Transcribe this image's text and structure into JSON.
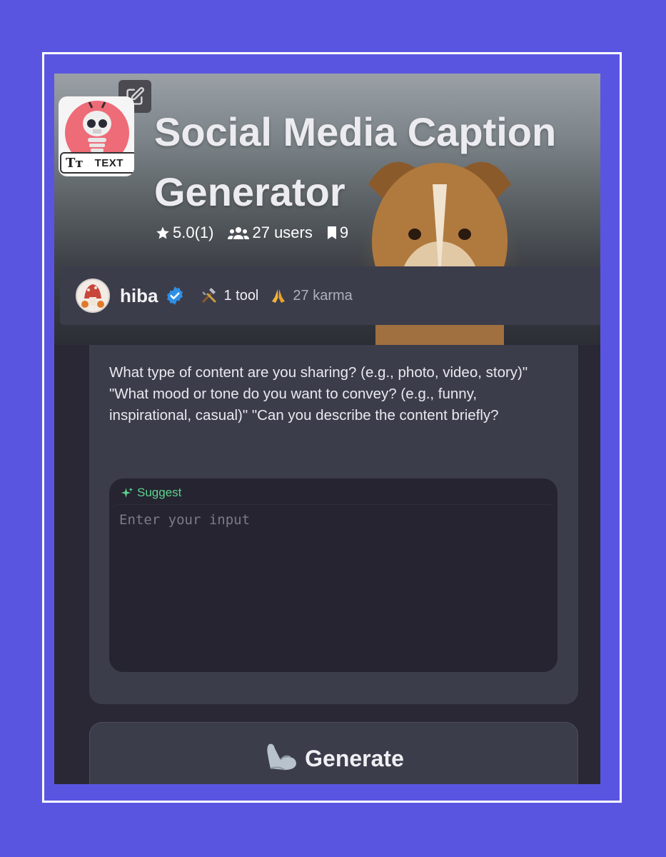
{
  "tool": {
    "title": "Social Media Caption Generator",
    "type_badge": "TEXT",
    "type_icon": "Tт"
  },
  "stats": {
    "rating": "5.0(1)",
    "users": "27 users",
    "saves": "9"
  },
  "author": {
    "name": "hiba",
    "tools": "1 tool",
    "karma": "27 karma"
  },
  "form": {
    "prompt": "What type of content are you sharing? (e.g., photo, video, story)\" \"What mood or tone do you want to convey? (e.g., funny, inspirational, casual)\" \"Can you describe the content briefly?",
    "suggest_label": "Suggest",
    "input_placeholder": "Enter your input",
    "input_value": ""
  },
  "actions": {
    "generate_label": "Generate"
  },
  "colors": {
    "background": "#5a55e0",
    "card": "#3c3d4b",
    "input": "#252430",
    "suggest": "#5fd18f",
    "verified": "#2f8fe6"
  },
  "icons": [
    "edit-icon",
    "star-icon",
    "users-icon",
    "bookmark-icon",
    "verified-badge-icon",
    "tools-icon",
    "pray-icon",
    "sparkle-icon",
    "flexed-biceps-icon"
  ]
}
